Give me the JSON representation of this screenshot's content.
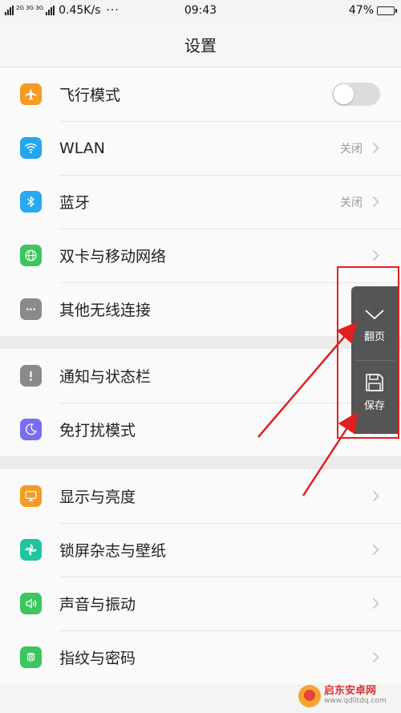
{
  "status_bar": {
    "network_type": "2G 3G 3G",
    "speed": "0.45K/s",
    "dots": "···",
    "time": "09:43",
    "battery_percent": "47%",
    "battery_level": 0.47
  },
  "header": {
    "title": "设置"
  },
  "groups": [
    [
      {
        "label": "飞行模式",
        "icon": "airplane-icon",
        "color": "#f59b23",
        "type": "toggle",
        "toggle_on": false
      },
      {
        "label": "WLAN",
        "icon": "wifi-icon",
        "color": "#23a6ee",
        "type": "value",
        "value": "关闭"
      },
      {
        "label": "蓝牙",
        "icon": "bluetooth-icon",
        "color": "#2aa8f2",
        "type": "value",
        "value": "关闭"
      },
      {
        "label": "双卡与移动网络",
        "icon": "globe-icon",
        "color": "#3dc65e",
        "type": "chevron"
      },
      {
        "label": "其他无线连接",
        "icon": "more-icon",
        "color": "#8a8a8a",
        "type": "chevron"
      }
    ],
    [
      {
        "label": "通知与状态栏",
        "icon": "exclamation-icon",
        "color": "#8a8a8a",
        "type": "chevron"
      },
      {
        "label": "免打扰模式",
        "icon": "moon-icon",
        "color": "#7a6ef0",
        "type": "chevron"
      }
    ],
    [
      {
        "label": "显示与亮度",
        "icon": "monitor-icon",
        "color": "#f59b23",
        "type": "chevron"
      },
      {
        "label": "锁屏杂志与壁纸",
        "icon": "pinwheel-icon",
        "color": "#22c4a0",
        "type": "chevron"
      },
      {
        "label": "声音与振动",
        "icon": "speaker-icon",
        "color": "#3dc65e",
        "type": "chevron"
      },
      {
        "label": "指纹与密码",
        "icon": "fingerprint-icon",
        "color": "#3dc65e",
        "type": "chevron"
      }
    ]
  ],
  "float_panel": {
    "page_turn_label": "翻页",
    "page_turn_icon": "chevron-down-icon",
    "save_label": "保存",
    "save_icon": "save-icon"
  },
  "watermark": {
    "text": "启东安卓网",
    "url": "www.qdlitdq.com"
  }
}
